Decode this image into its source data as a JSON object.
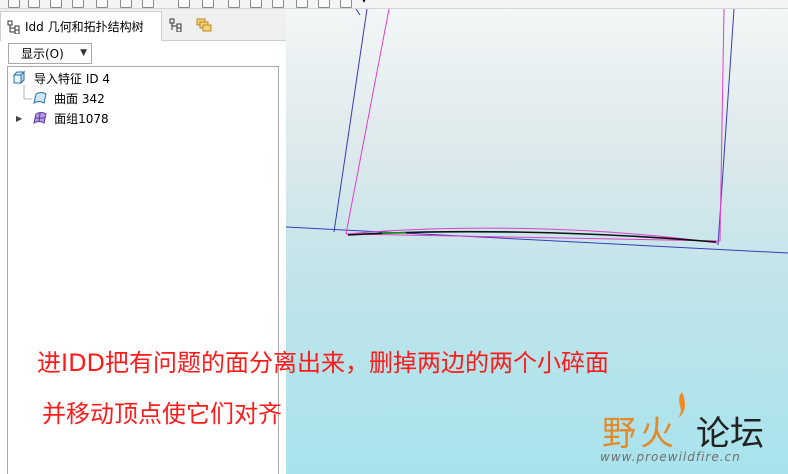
{
  "panel": {
    "tab_title": "Idd 几何和拓扑结构树"
  },
  "display_button": {
    "label": "显示(O)"
  },
  "tree": {
    "root": {
      "label": "导入特征 ID 4",
      "icon": "feature-box-icon"
    },
    "children": [
      {
        "label": "曲面 342",
        "icon": "surface-icon"
      },
      {
        "label": "面组1078",
        "icon": "quilt-icon",
        "expandable": true
      }
    ]
  },
  "annotation": {
    "line1": "进IDD把有问题的面分离出来，删掉两边的两个小碎面",
    "line2": "并移动顶点使它们对齐"
  },
  "watermark": {
    "chars": [
      "野",
      "火",
      "论坛"
    ],
    "url": "www.proewildfire.cn"
  },
  "colors": {
    "annotation": "#ff1a1a",
    "edge_blue": "#3b3bb8",
    "edge_magenta": "#e040c8",
    "logo_orange": "#f28a1c"
  }
}
